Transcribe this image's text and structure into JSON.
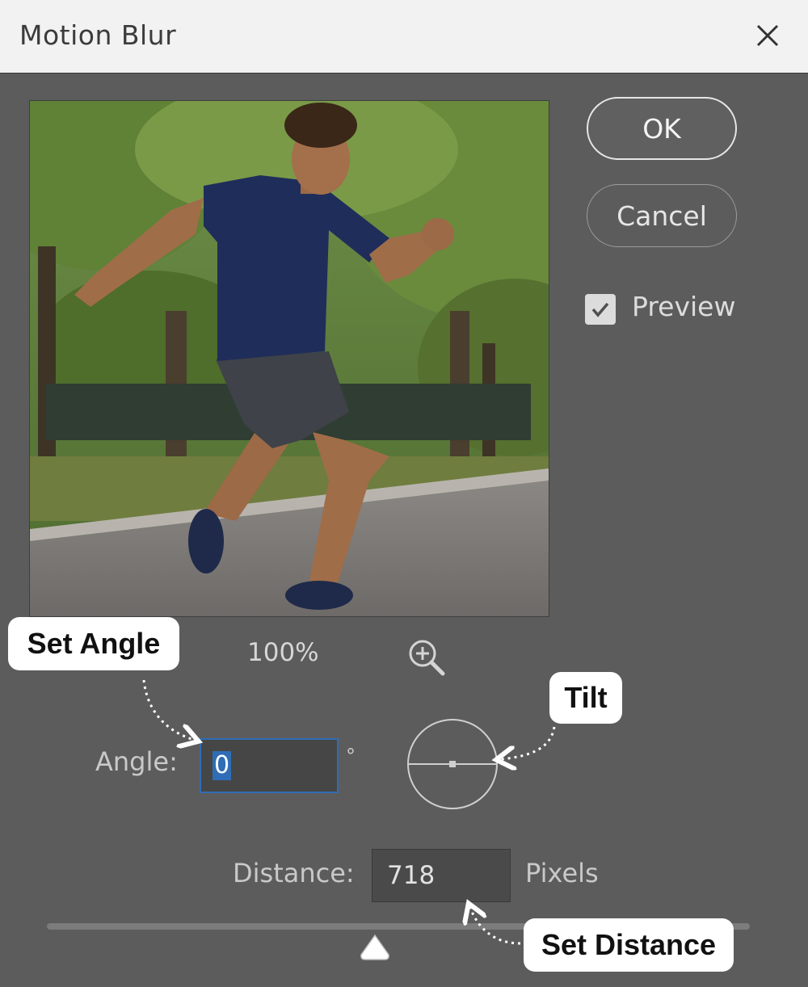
{
  "dialog": {
    "title": "Motion Blur"
  },
  "buttons": {
    "ok_label": "OK",
    "cancel_label": "Cancel"
  },
  "preview": {
    "label": "Preview",
    "checked": true,
    "zoom_level": "100%"
  },
  "angle": {
    "label": "Angle:",
    "value": "0",
    "unit": "°"
  },
  "distance": {
    "label": "Distance:",
    "value": "718",
    "unit": "Pixels"
  },
  "annotations": {
    "set_angle": "Set Angle",
    "tilt": "Tilt",
    "set_distance": "Set Distance"
  },
  "icons": {
    "close": "close-icon",
    "checkmark": "checkmark-icon",
    "zoom_in": "zoom-in-icon",
    "slider_thumb": "triangle-up-icon"
  },
  "colors": {
    "titlebar_bg": "#f2f2f2",
    "dialog_bg": "#5c5c5c",
    "selection_blue": "#2f6db6",
    "callout_bg": "#ffffff"
  }
}
